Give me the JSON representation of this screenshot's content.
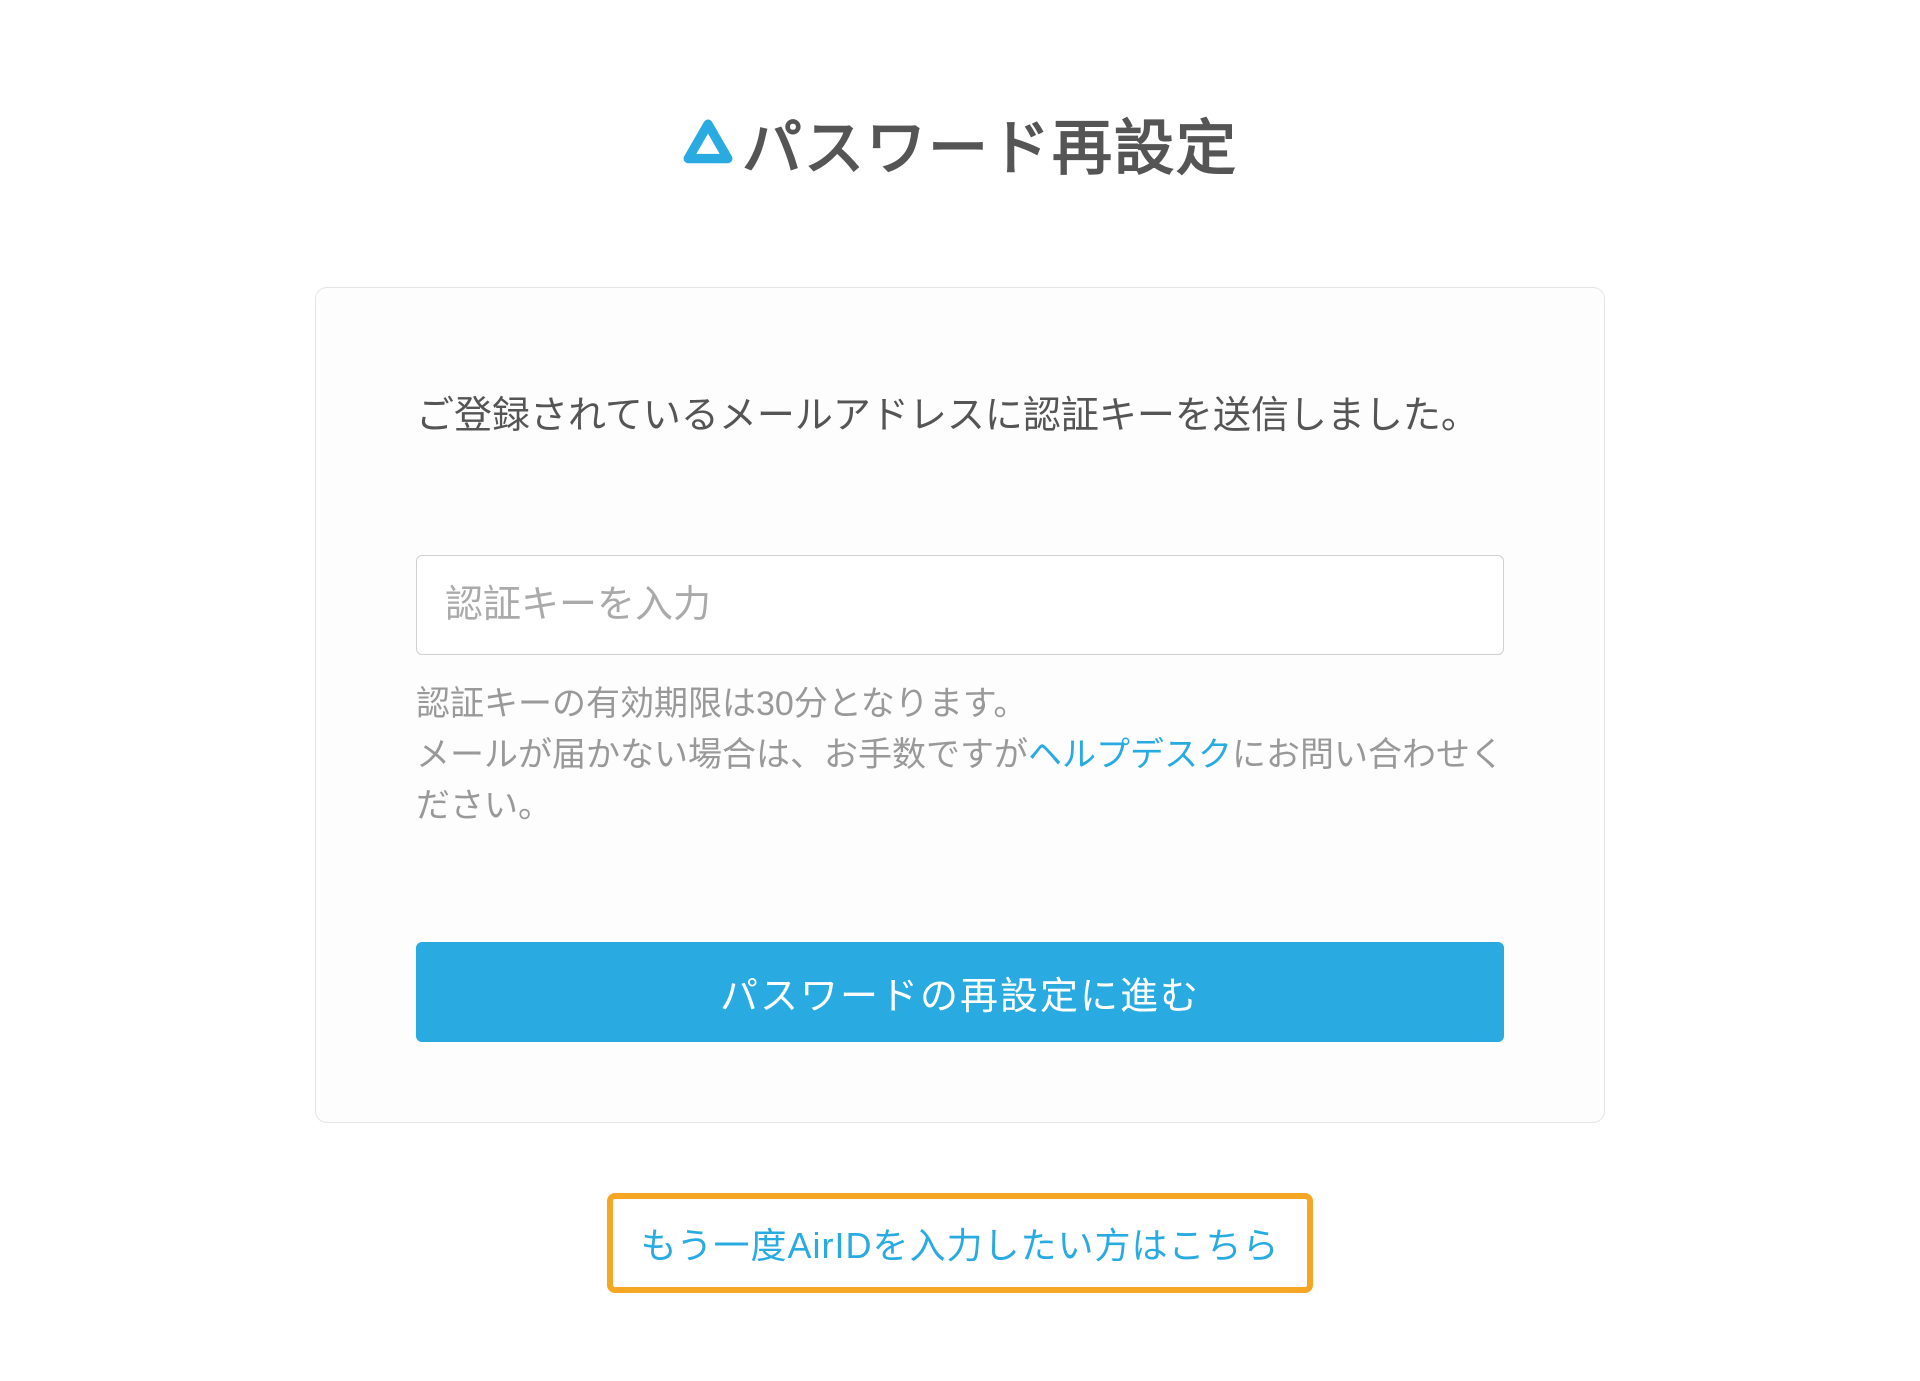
{
  "header": {
    "title": "パスワード再設定"
  },
  "card": {
    "instruction": "ご登録されているメールアドレスに認証キーを送信しました。",
    "input_placeholder": "認証キーを入力",
    "help_text_part1": "認証キーの有効期限は30分となります。",
    "help_text_part2_before": "メールが届かない場合は、お手数ですが",
    "help_link_label": "ヘルプデスク",
    "help_text_part2_after": "にお問い合わせください。",
    "submit_label": "パスワードの再設定に進む"
  },
  "footer": {
    "back_link_label": "もう一度AirIDを入力したい方はこちら"
  },
  "colors": {
    "accent": "#29abe2",
    "highlight_border": "#f5a623"
  }
}
